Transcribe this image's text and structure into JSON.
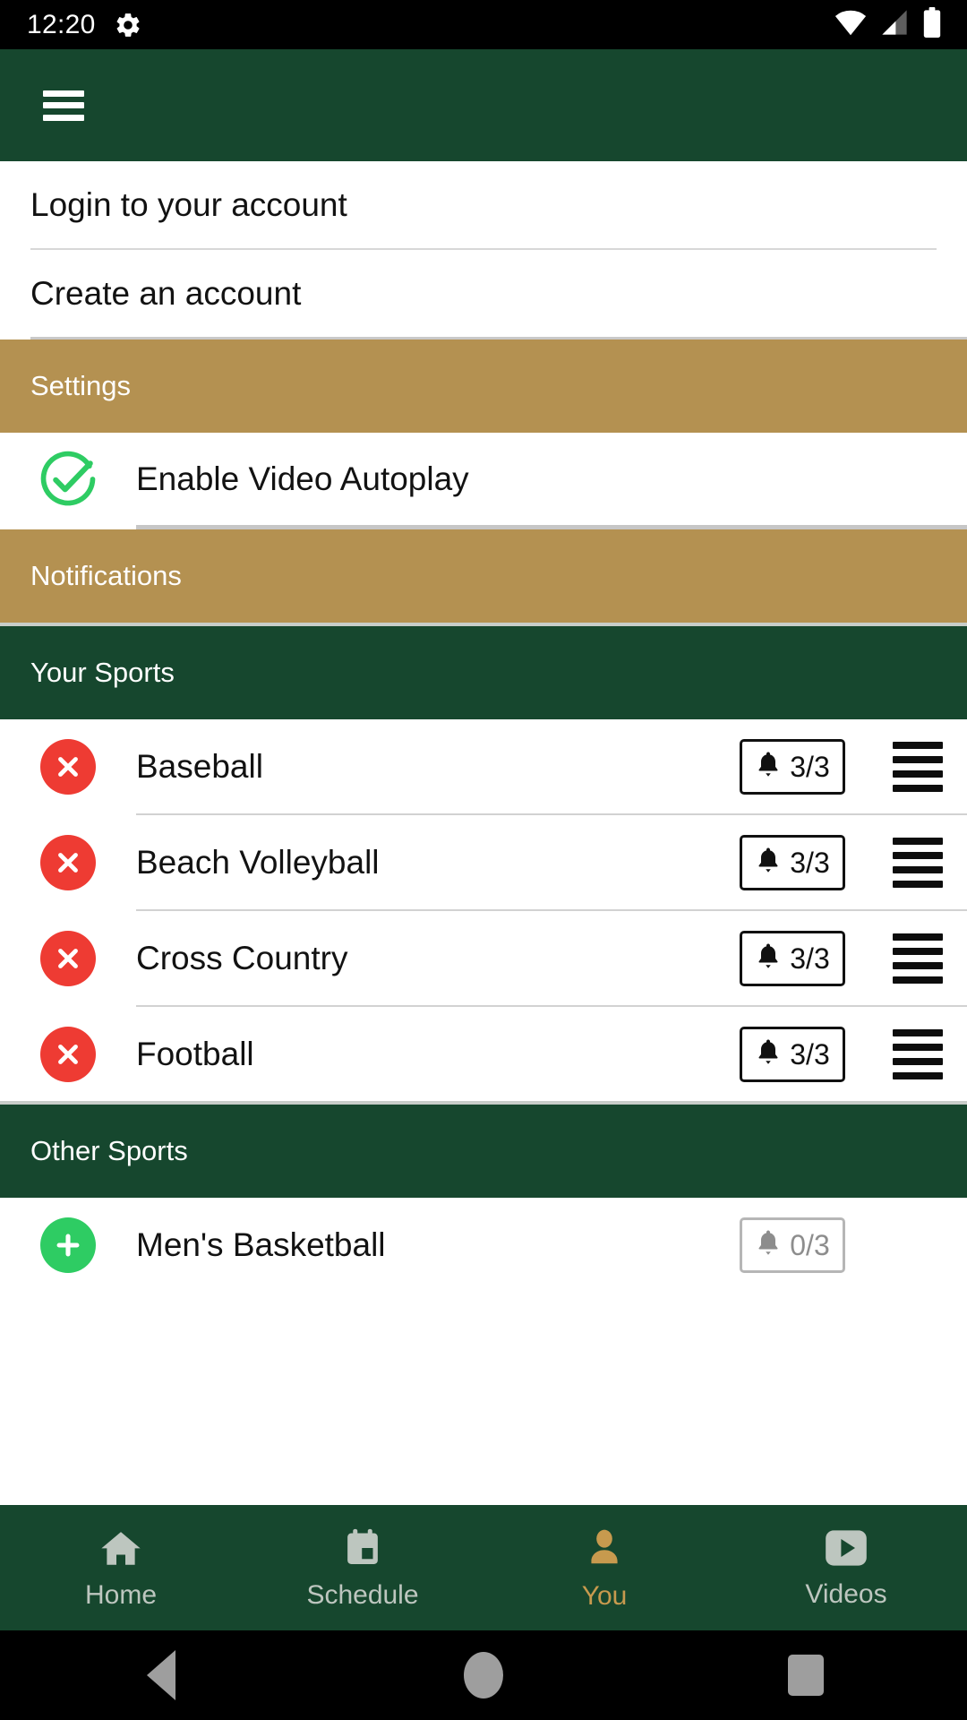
{
  "status_bar": {
    "time": "12:20",
    "icons": [
      "gear-icon",
      "wifi-icon",
      "cellular-signal-icon",
      "battery-icon"
    ]
  },
  "app_bar": {
    "menu_icon": "hamburger-menu-icon"
  },
  "account": {
    "login_label": "Login to your account",
    "create_label": "Create an account"
  },
  "settings": {
    "header": "Settings",
    "autoplay_label": "Enable Video Autoplay",
    "autoplay_checked": true,
    "check_icon": "check-circle-icon"
  },
  "notifications": {
    "header": "Notifications"
  },
  "your_sports": {
    "header": "Your Sports",
    "items": [
      {
        "name": "Baseball",
        "count": "3/3",
        "action": "remove",
        "enabled": true
      },
      {
        "name": "Beach Volleyball",
        "count": "3/3",
        "action": "remove",
        "enabled": true
      },
      {
        "name": "Cross Country",
        "count": "3/3",
        "action": "remove",
        "enabled": true
      },
      {
        "name": "Football",
        "count": "3/3",
        "action": "remove",
        "enabled": true
      }
    ]
  },
  "other_sports": {
    "header": "Other Sports",
    "items": [
      {
        "name": "Men's Basketball",
        "count": "0/3",
        "action": "add",
        "enabled": false
      }
    ]
  },
  "bottom_nav": {
    "items": [
      {
        "label": "Home",
        "icon": "home-icon",
        "active": false
      },
      {
        "label": "Schedule",
        "icon": "calendar-icon",
        "active": false
      },
      {
        "label": "You",
        "icon": "person-icon",
        "active": true
      },
      {
        "label": "Videos",
        "icon": "video-play-icon",
        "active": false
      }
    ]
  },
  "android_nav": {
    "back": "back-triangle-icon",
    "home": "home-circle-icon",
    "recents": "recents-square-icon"
  },
  "colors": {
    "green": "#16472e",
    "gold": "#b49151",
    "red": "#ee3b33",
    "green_check": "#2ecc63",
    "accent_gold_text": "#c79a4e"
  }
}
